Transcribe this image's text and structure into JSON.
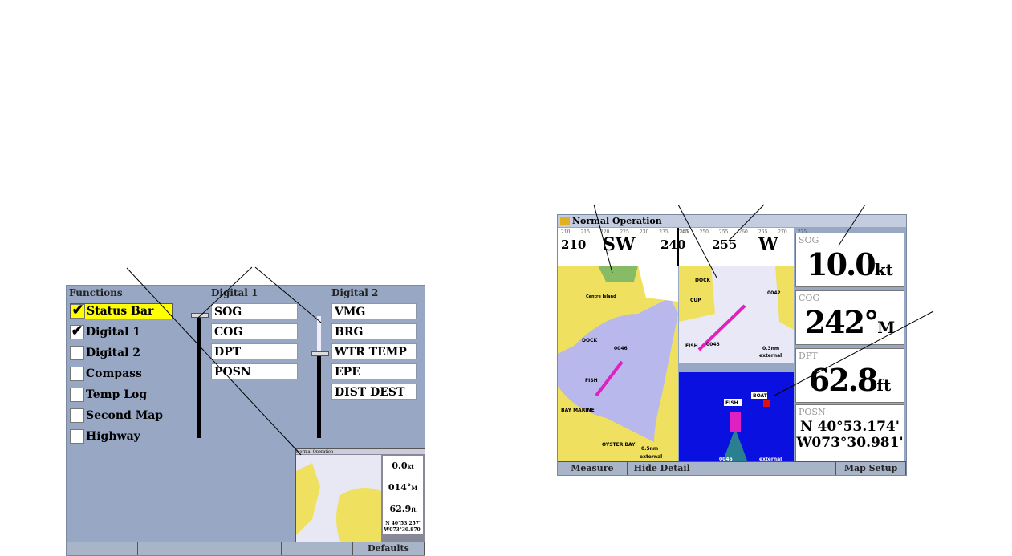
{
  "setup_screen": {
    "headers": {
      "functions": "Functions",
      "digital1": "Digital 1",
      "digital2": "Digital 2"
    },
    "functions": [
      {
        "label": "Status Bar",
        "checked": true,
        "selected": true
      },
      {
        "label": "Digital 1",
        "checked": true,
        "selected": false
      },
      {
        "label": "Digital 2",
        "checked": false,
        "selected": false
      },
      {
        "label": "Compass",
        "checked": false,
        "selected": false
      },
      {
        "label": "Temp Log",
        "checked": false,
        "selected": false
      },
      {
        "label": "Second Map",
        "checked": false,
        "selected": false
      },
      {
        "label": "Highway",
        "checked": false,
        "selected": false
      }
    ],
    "check_mark": "✔",
    "digital1": [
      "SOG",
      "COG",
      "DPT",
      "POSN"
    ],
    "digital2": [
      "VMG",
      "BRG",
      "WTR TEMP",
      "EPE",
      "DIST DEST"
    ],
    "preview": {
      "title": "Normal Operation",
      "sog": "0.0",
      "sog_unit": "kt",
      "cog": "014°",
      "cog_unit": "M",
      "dpt": "62.9",
      "dpt_unit": "ft",
      "posn": "N 40°53.257' W073°30.870'"
    },
    "buttons": [
      "",
      "",
      "",
      "",
      "Defaults"
    ]
  },
  "main_screen": {
    "title": "Normal Operation",
    "compass": {
      "left_numbers": [
        "210",
        "240"
      ],
      "left_heading": "SW",
      "right_number": "255",
      "right_heading": "W",
      "ticks_left": [
        "210",
        "215",
        "220",
        "225",
        "230",
        "235",
        "240"
      ],
      "ticks_right": [
        "245",
        "250",
        "255",
        "260",
        "265",
        "270",
        "275"
      ]
    },
    "map_labels": {
      "left": [
        "Centre Island",
        "DOCK",
        "0046",
        "FISH",
        "BAY MARINE",
        "OYSTER BAY",
        "0.5nm",
        "external"
      ],
      "upper": [
        "DOCK",
        "CUP",
        "0042",
        "FISH",
        "0048",
        "0.3nm",
        "external"
      ],
      "lower": [
        "FISH",
        "BOAT",
        "0046",
        "external"
      ]
    },
    "panels": [
      {
        "label": "SOG",
        "value": "10.0",
        "unit": "kt"
      },
      {
        "label": "COG",
        "value": "242°",
        "unit": "M"
      },
      {
        "label": "DPT",
        "value": "62.8",
        "unit": "ft"
      },
      {
        "label": "POSN",
        "line1": "N  40°53.174'",
        "line2": "W073°30.981'"
      }
    ],
    "buttons": [
      "Measure",
      "Hide Detail",
      "",
      "",
      "Map Setup"
    ]
  }
}
